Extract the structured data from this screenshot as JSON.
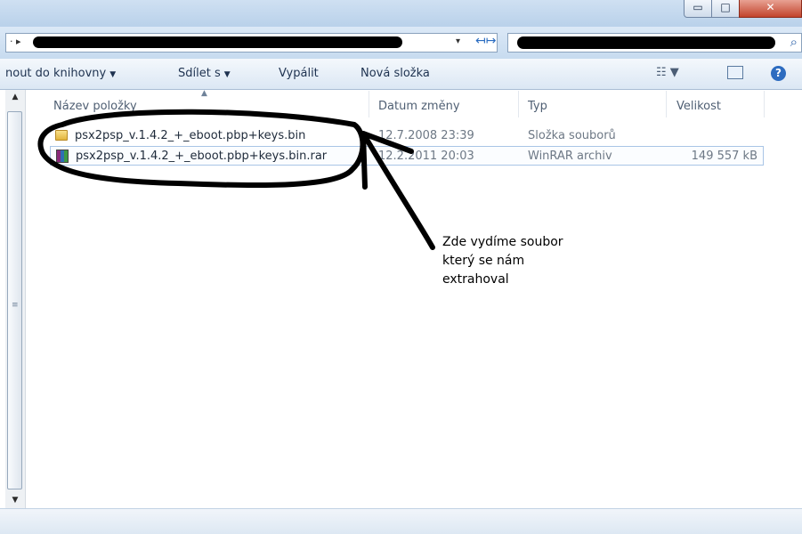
{
  "titlebar": {
    "minimize_glyph": "▭",
    "maximize_glyph": "□",
    "close_glyph": "✕"
  },
  "address": {
    "chevron": "· ▸",
    "dropdown_glyph": "▾",
    "refresh_glyph": "↤↦"
  },
  "search": {
    "icon_glyph": "⌕"
  },
  "toolbar": {
    "library_label": "nout do knihovny",
    "share_label": "Sdílet s",
    "burn_label": "Vypálit",
    "new_folder_label": "Nová složka",
    "dropdown_glyph": "▼",
    "views_glyph": "☷ ▼",
    "help_glyph": "?"
  },
  "columns": {
    "name": "Název položky",
    "date": "Datum změny",
    "type": "Typ",
    "size": "Velikost"
  },
  "files": [
    {
      "name": "psx2psp_v.1.4.2_+_eboot.pbp+keys.bin",
      "date": "12.7.2008 23:39",
      "type": "Složka souborů",
      "size": "",
      "icon": "folder-icon"
    },
    {
      "name": "psx2psp_v.1.4.2_+_eboot.pbp+keys.bin.rar",
      "date": "12.2.2011 20:03",
      "type": "WinRAR archiv",
      "size": "149 557 kB",
      "icon": "winrar-archive-icon"
    }
  ],
  "annotation": {
    "line1": "Zde vydíme soubor",
    "line2": "který se nám",
    "line3": "extrahoval"
  },
  "scrollbar": {
    "up_glyph": "▲",
    "down_glyph": "▼",
    "grip_glyph": "≡"
  },
  "colors": {
    "accent": "#2d6cc0",
    "annotation_ink": "#000000"
  }
}
